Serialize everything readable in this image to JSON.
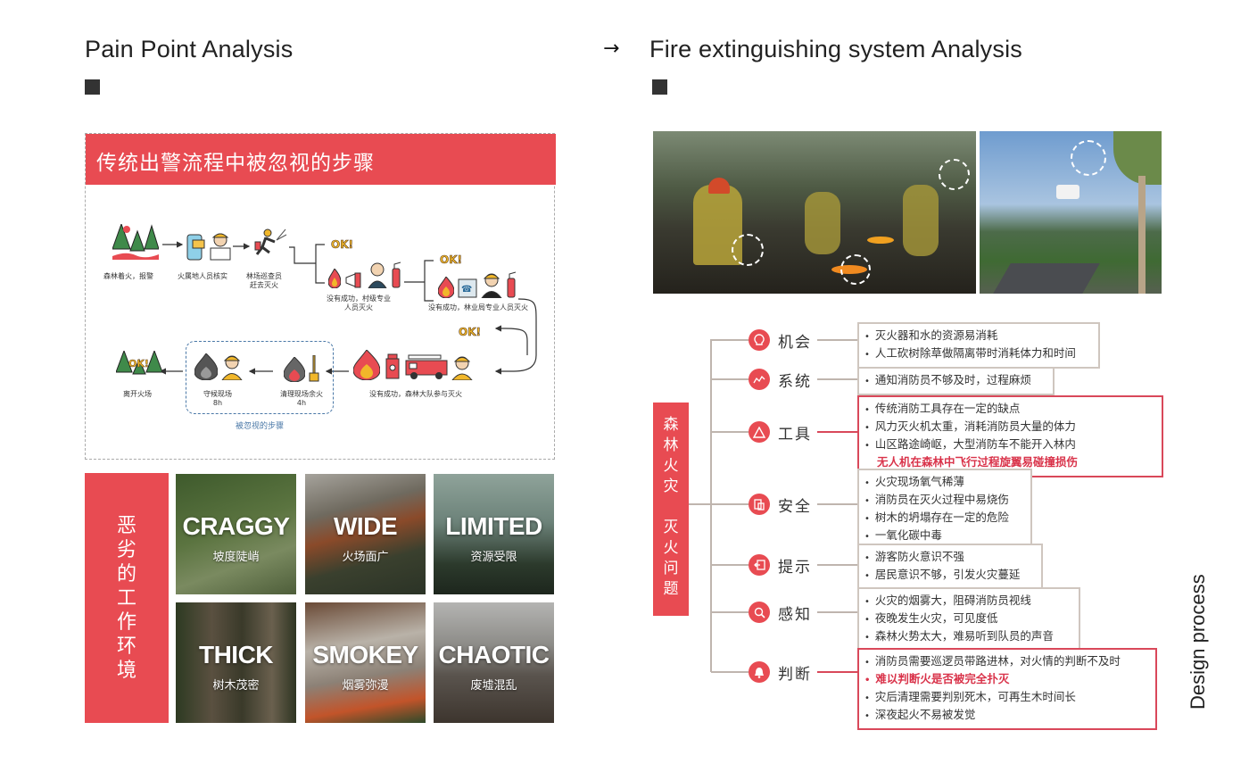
{
  "left": {
    "title": "Pain Point Analysis",
    "flow_panel": {
      "heading": "传统出警流程中被忽视的步骤",
      "steps": {
        "alarm": "森林着火，报警",
        "verify": "火属地人员核实",
        "patrol_line1": "林场巡查员",
        "patrol_line2": "赶去灭火",
        "village_line1": "没有成功，村级专业",
        "village_line2": "人员灭火",
        "bureau": "没有成功，林业局专业人员灭火",
        "brigade": "没有成功，森林大队参与灭火",
        "clear": "清理现场余火",
        "clear_time": "4h",
        "guard": "守候现场",
        "guard_time": "8h",
        "leave": "离开火场"
      },
      "ok_label": "OK!",
      "ignored_label": "被忽视的步骤"
    },
    "environment": {
      "side_label": [
        "恶",
        "劣",
        "的",
        "工",
        "作",
        "环",
        "境"
      ],
      "tiles": [
        {
          "en": "CRAGGY",
          "zh": "坡度陡峭"
        },
        {
          "en": "WIDE",
          "zh": "火场面广"
        },
        {
          "en": "LIMITED",
          "zh": "资源受限"
        },
        {
          "en": "THICK",
          "zh": "树木茂密"
        },
        {
          "en": "SMOKEY",
          "zh": "烟雾弥漫"
        },
        {
          "en": "CHAOTIC",
          "zh": "废墟混乱"
        }
      ]
    }
  },
  "right": {
    "title": "Fire extinguishing system Analysis",
    "arrow": "→",
    "mindmap": {
      "root_top": [
        "森",
        "林",
        "火",
        "灾"
      ],
      "root_bottom": [
        "灭",
        "火",
        "问",
        "题"
      ],
      "categories": [
        {
          "label": "机会",
          "icon": "lightbulb-icon",
          "items": [
            "灭火器和水的资源易消耗",
            "人工砍树除草做隔离带时消耗体力和时间"
          ]
        },
        {
          "label": "系统",
          "icon": "chart-icon",
          "items": [
            "通知消防员不够及时，过程麻烦"
          ]
        },
        {
          "label": "工具",
          "icon": "warning-triangle-icon",
          "items": [
            "传统消防工具存在一定的缺点",
            "风力灭火机太重，消耗消防员大量的体力",
            "山区路途崎岖，大型消防车不能开入林内"
          ],
          "highlight": "无人机在森林中飞行过程旋翼易碰撞损伤"
        },
        {
          "label": "安全",
          "icon": "device-icon",
          "items": [
            "火灾现场氧气稀薄",
            "消防员在灭火过程中易烧伤",
            "树木的坍塌存在一定的危险",
            "一氧化碳中毒"
          ]
        },
        {
          "label": "提示",
          "icon": "exit-icon",
          "items": [
            "游客防火意识不强",
            "居民意识不够，引发火灾蔓延"
          ]
        },
        {
          "label": "感知",
          "icon": "magnifier-icon",
          "items": [
            "火灾的烟雾大，阻碍消防员视线",
            "夜晚发生火灾，可见度低",
            "森林火势太大，难易听到队员的声音"
          ]
        },
        {
          "label": "判断",
          "icon": "bell-icon",
          "items": [
            "消防员需要巡逻员带路进林，对火情的判断不及时",
            "难以判断火是否被完全扑灭",
            "灾后清理需要判别死木，可再生木时间长",
            "深夜起火不易被发觉"
          ]
        }
      ]
    },
    "side_label": "Design process"
  },
  "colors": {
    "accent": "#e84b52",
    "highlight_border": "#d9485a",
    "line": "#bfb5ae",
    "ignored_blue": "#4a78a7"
  }
}
